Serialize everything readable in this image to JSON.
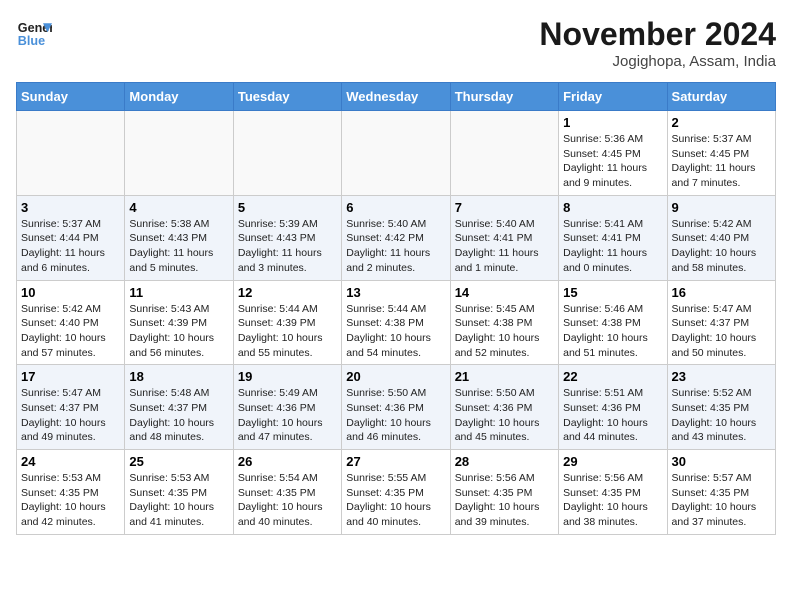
{
  "header": {
    "logo_line1": "General",
    "logo_line2": "Blue",
    "month": "November 2024",
    "location": "Jogighopa, Assam, India"
  },
  "weekdays": [
    "Sunday",
    "Monday",
    "Tuesday",
    "Wednesday",
    "Thursday",
    "Friday",
    "Saturday"
  ],
  "weeks": [
    [
      {
        "day": "",
        "info": ""
      },
      {
        "day": "",
        "info": ""
      },
      {
        "day": "",
        "info": ""
      },
      {
        "day": "",
        "info": ""
      },
      {
        "day": "",
        "info": ""
      },
      {
        "day": "1",
        "info": "Sunrise: 5:36 AM\nSunset: 4:45 PM\nDaylight: 11 hours and 9 minutes."
      },
      {
        "day": "2",
        "info": "Sunrise: 5:37 AM\nSunset: 4:45 PM\nDaylight: 11 hours and 7 minutes."
      }
    ],
    [
      {
        "day": "3",
        "info": "Sunrise: 5:37 AM\nSunset: 4:44 PM\nDaylight: 11 hours and 6 minutes."
      },
      {
        "day": "4",
        "info": "Sunrise: 5:38 AM\nSunset: 4:43 PM\nDaylight: 11 hours and 5 minutes."
      },
      {
        "day": "5",
        "info": "Sunrise: 5:39 AM\nSunset: 4:43 PM\nDaylight: 11 hours and 3 minutes."
      },
      {
        "day": "6",
        "info": "Sunrise: 5:40 AM\nSunset: 4:42 PM\nDaylight: 11 hours and 2 minutes."
      },
      {
        "day": "7",
        "info": "Sunrise: 5:40 AM\nSunset: 4:41 PM\nDaylight: 11 hours and 1 minute."
      },
      {
        "day": "8",
        "info": "Sunrise: 5:41 AM\nSunset: 4:41 PM\nDaylight: 11 hours and 0 minutes."
      },
      {
        "day": "9",
        "info": "Sunrise: 5:42 AM\nSunset: 4:40 PM\nDaylight: 10 hours and 58 minutes."
      }
    ],
    [
      {
        "day": "10",
        "info": "Sunrise: 5:42 AM\nSunset: 4:40 PM\nDaylight: 10 hours and 57 minutes."
      },
      {
        "day": "11",
        "info": "Sunrise: 5:43 AM\nSunset: 4:39 PM\nDaylight: 10 hours and 56 minutes."
      },
      {
        "day": "12",
        "info": "Sunrise: 5:44 AM\nSunset: 4:39 PM\nDaylight: 10 hours and 55 minutes."
      },
      {
        "day": "13",
        "info": "Sunrise: 5:44 AM\nSunset: 4:38 PM\nDaylight: 10 hours and 54 minutes."
      },
      {
        "day": "14",
        "info": "Sunrise: 5:45 AM\nSunset: 4:38 PM\nDaylight: 10 hours and 52 minutes."
      },
      {
        "day": "15",
        "info": "Sunrise: 5:46 AM\nSunset: 4:38 PM\nDaylight: 10 hours and 51 minutes."
      },
      {
        "day": "16",
        "info": "Sunrise: 5:47 AM\nSunset: 4:37 PM\nDaylight: 10 hours and 50 minutes."
      }
    ],
    [
      {
        "day": "17",
        "info": "Sunrise: 5:47 AM\nSunset: 4:37 PM\nDaylight: 10 hours and 49 minutes."
      },
      {
        "day": "18",
        "info": "Sunrise: 5:48 AM\nSunset: 4:37 PM\nDaylight: 10 hours and 48 minutes."
      },
      {
        "day": "19",
        "info": "Sunrise: 5:49 AM\nSunset: 4:36 PM\nDaylight: 10 hours and 47 minutes."
      },
      {
        "day": "20",
        "info": "Sunrise: 5:50 AM\nSunset: 4:36 PM\nDaylight: 10 hours and 46 minutes."
      },
      {
        "day": "21",
        "info": "Sunrise: 5:50 AM\nSunset: 4:36 PM\nDaylight: 10 hours and 45 minutes."
      },
      {
        "day": "22",
        "info": "Sunrise: 5:51 AM\nSunset: 4:36 PM\nDaylight: 10 hours and 44 minutes."
      },
      {
        "day": "23",
        "info": "Sunrise: 5:52 AM\nSunset: 4:35 PM\nDaylight: 10 hours and 43 minutes."
      }
    ],
    [
      {
        "day": "24",
        "info": "Sunrise: 5:53 AM\nSunset: 4:35 PM\nDaylight: 10 hours and 42 minutes."
      },
      {
        "day": "25",
        "info": "Sunrise: 5:53 AM\nSunset: 4:35 PM\nDaylight: 10 hours and 41 minutes."
      },
      {
        "day": "26",
        "info": "Sunrise: 5:54 AM\nSunset: 4:35 PM\nDaylight: 10 hours and 40 minutes."
      },
      {
        "day": "27",
        "info": "Sunrise: 5:55 AM\nSunset: 4:35 PM\nDaylight: 10 hours and 40 minutes."
      },
      {
        "day": "28",
        "info": "Sunrise: 5:56 AM\nSunset: 4:35 PM\nDaylight: 10 hours and 39 minutes."
      },
      {
        "day": "29",
        "info": "Sunrise: 5:56 AM\nSunset: 4:35 PM\nDaylight: 10 hours and 38 minutes."
      },
      {
        "day": "30",
        "info": "Sunrise: 5:57 AM\nSunset: 4:35 PM\nDaylight: 10 hours and 37 minutes."
      }
    ]
  ]
}
